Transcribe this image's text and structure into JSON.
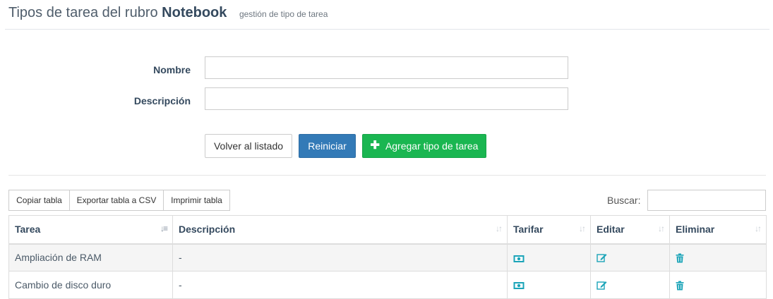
{
  "header": {
    "title_prefix": "Tipos de tarea del rubro",
    "title_bold": "Notebook",
    "subtitle": "gestión de tipo de tarea"
  },
  "form": {
    "nombre_label": "Nombre",
    "nombre_value": "",
    "descripcion_label": "Descripción",
    "descripcion_value": ""
  },
  "buttons": {
    "volver": "Volver al listado",
    "reiniciar": "Reiniciar",
    "agregar": "Agregar tipo de tarea"
  },
  "table_tools": {
    "copy": "Copiar tabla",
    "export_csv": "Exportar tabla a CSV",
    "print": "Imprimir tabla",
    "search_label": "Buscar:",
    "search_value": ""
  },
  "table": {
    "columns": [
      "Tarea",
      "Descripción",
      "Tarifar",
      "Editar",
      "Eliminar"
    ],
    "rows": [
      {
        "tarea": "Ampliación de RAM",
        "descripcion": "-"
      },
      {
        "tarea": "Cambio de disco duro",
        "descripcion": "-"
      }
    ]
  },
  "icons": {
    "add": "plus-icon",
    "tarifar": "money-icon",
    "editar": "edit-icon",
    "eliminar": "trash-icon",
    "sort": "sort-icon"
  },
  "colors": {
    "primary": "#337ab7",
    "success": "#1ab651",
    "icon_teal": "#1ba4b8",
    "text": "#34495e"
  }
}
